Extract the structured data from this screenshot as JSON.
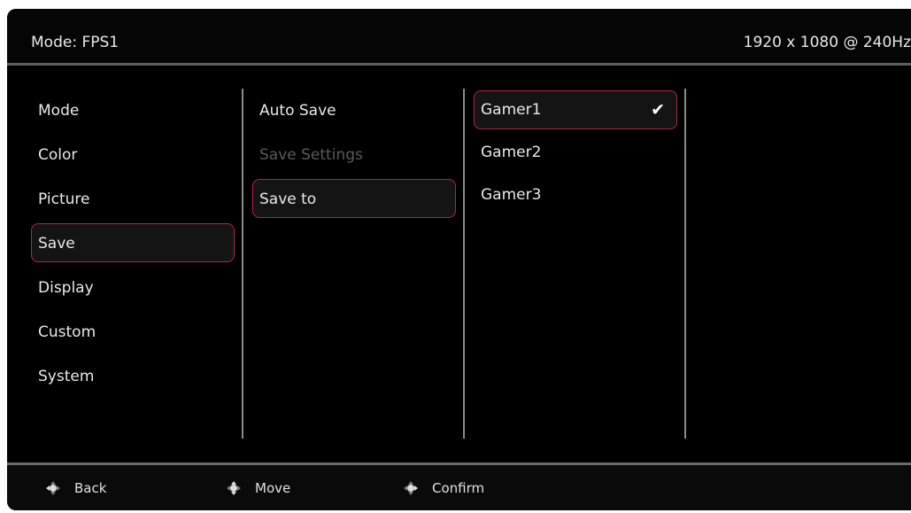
{
  "header": {
    "mode": "Mode: FPS1",
    "resolution": "1920 x 1080 @ 240Hz"
  },
  "main_menu": [
    {
      "label": "Mode"
    },
    {
      "label": "Color"
    },
    {
      "label": "Picture"
    },
    {
      "label": "Save",
      "selected": true
    },
    {
      "label": "Display"
    },
    {
      "label": "Custom"
    },
    {
      "label": "System"
    }
  ],
  "save_menu": [
    {
      "label": "Auto Save"
    },
    {
      "label": "Save Settings",
      "disabled": true
    },
    {
      "label": "Save to",
      "selected": true
    }
  ],
  "save_to_options": [
    {
      "label": "Gamer1",
      "selected": true,
      "checked": true
    },
    {
      "label": "Gamer2"
    },
    {
      "label": "Gamer3"
    }
  ],
  "footer": {
    "back": "Back",
    "move": "Move",
    "confirm": "Confirm"
  },
  "colors": {
    "accent": "#b2244a",
    "background": "#000000"
  },
  "icons": {
    "check": "checkmark-icon",
    "nav": "dpad-icon"
  }
}
